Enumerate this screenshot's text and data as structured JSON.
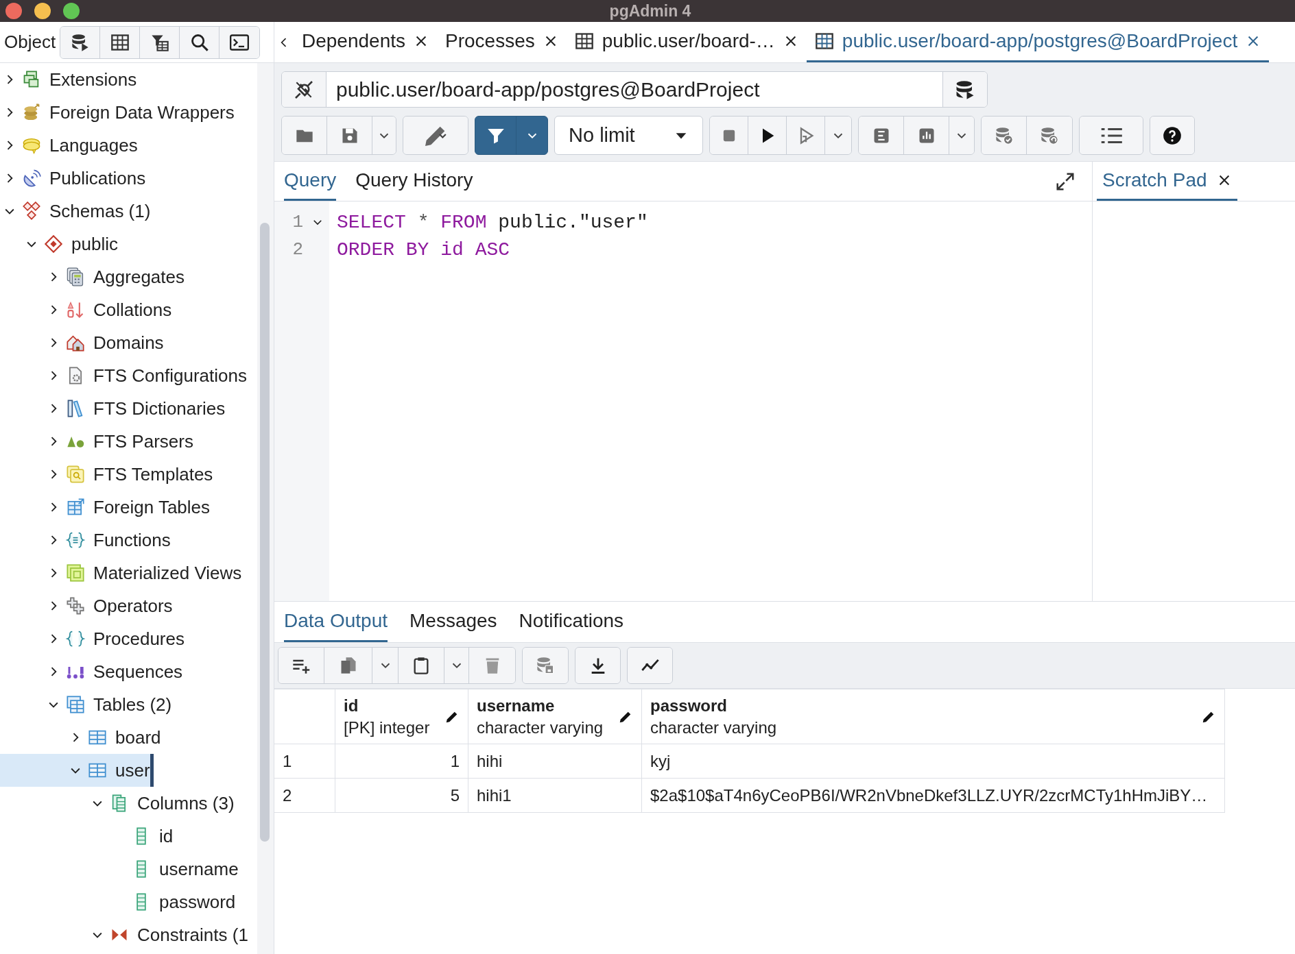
{
  "window": {
    "title": "pgAdmin 4"
  },
  "object_explorer": {
    "title": "Object",
    "tree": [
      {
        "label": "Extensions",
        "kind": "extension",
        "expanded": false,
        "selected": false
      },
      {
        "label": "Foreign Data Wrappers",
        "kind": "fdw",
        "expanded": false,
        "selected": false
      },
      {
        "label": "Languages",
        "kind": "language",
        "expanded": false,
        "selected": false
      },
      {
        "label": "Publications",
        "kind": "publication",
        "expanded": false,
        "selected": false
      },
      {
        "label": "Schemas (1)",
        "kind": "schemas",
        "expanded": true,
        "selected": false,
        "children": [
          {
            "label": "public",
            "kind": "schema",
            "expanded": true,
            "selected": false,
            "children": [
              {
                "label": "Aggregates",
                "kind": "aggregate",
                "expanded": false,
                "selected": false
              },
              {
                "label": "Collations",
                "kind": "collation",
                "expanded": false,
                "selected": false
              },
              {
                "label": "Domains",
                "kind": "domain",
                "expanded": false,
                "selected": false
              },
              {
                "label": "FTS Configurations",
                "kind": "fts-config",
                "expanded": false,
                "selected": false
              },
              {
                "label": "FTS Dictionaries",
                "kind": "fts-dict",
                "expanded": false,
                "selected": false
              },
              {
                "label": "FTS Parsers",
                "kind": "fts-parser",
                "expanded": false,
                "selected": false
              },
              {
                "label": "FTS Templates",
                "kind": "fts-template",
                "expanded": false,
                "selected": false
              },
              {
                "label": "Foreign Tables",
                "kind": "foreign-table",
                "expanded": false,
                "selected": false
              },
              {
                "label": "Functions",
                "kind": "function",
                "expanded": false,
                "selected": false
              },
              {
                "label": "Materialized Views",
                "kind": "matview",
                "expanded": false,
                "selected": false
              },
              {
                "label": "Operators",
                "kind": "operator",
                "expanded": false,
                "selected": false
              },
              {
                "label": "Procedures",
                "kind": "procedure",
                "expanded": false,
                "selected": false
              },
              {
                "label": "Sequences",
                "kind": "sequence",
                "expanded": false,
                "selected": false
              },
              {
                "label": "Tables (2)",
                "kind": "tables",
                "expanded": true,
                "selected": false,
                "children": [
                  {
                    "label": "board",
                    "kind": "table",
                    "expanded": false,
                    "selected": false
                  },
                  {
                    "label": "user",
                    "kind": "table",
                    "expanded": true,
                    "selected": true,
                    "children": [
                      {
                        "label": "Columns (3)",
                        "kind": "columns",
                        "expanded": true,
                        "selected": false,
                        "children": [
                          {
                            "label": "id",
                            "kind": "column",
                            "selected": false
                          },
                          {
                            "label": "username",
                            "kind": "column",
                            "selected": false
                          },
                          {
                            "label": "password",
                            "kind": "column",
                            "selected": false
                          }
                        ]
                      },
                      {
                        "label": "Constraints (1",
                        "kind": "constraint",
                        "expanded": true,
                        "selected": false
                      }
                    ]
                  }
                ]
              }
            ]
          }
        ]
      }
    ]
  },
  "tabs": [
    {
      "label": "Dependents",
      "kind": "panel",
      "selected": false
    },
    {
      "label": "Processes",
      "kind": "panel",
      "selected": false
    },
    {
      "label": "public.user/board-…",
      "kind": "query",
      "selected": false
    },
    {
      "label": "public.user/board-app/postgres@BoardProject",
      "kind": "query",
      "selected": true
    }
  ],
  "query_tool": {
    "connection": "public.user/board-app/postgres@BoardProject",
    "row_limit": "No limit",
    "editor_tabs": [
      {
        "label": "Query",
        "selected": true
      },
      {
        "label": "Query History",
        "selected": false
      }
    ],
    "scratch_pad": {
      "label": "Scratch Pad",
      "selected": true
    },
    "lines": [
      {
        "number": "1",
        "foldable": true,
        "tokens": [
          {
            "text": "SELECT",
            "kind": "keyword"
          },
          {
            "text": " * ",
            "kind": "operator"
          },
          {
            "text": "FROM",
            "kind": "keyword"
          },
          {
            "text": " public.\"user\"",
            "kind": "plain"
          }
        ]
      },
      {
        "number": "2",
        "foldable": false,
        "tokens": [
          {
            "text": "ORDER BY id ASC",
            "kind": "keyword"
          }
        ]
      }
    ]
  },
  "output": {
    "tabs": [
      {
        "label": "Data Output",
        "selected": true
      },
      {
        "label": "Messages",
        "selected": false
      },
      {
        "label": "Notifications",
        "selected": false
      }
    ],
    "columns": [
      {
        "name": "id",
        "type": "[PK] integer",
        "kind": "number"
      },
      {
        "name": "username",
        "type": "character varying",
        "kind": "text"
      },
      {
        "name": "password",
        "type": "character varying",
        "kind": "text"
      }
    ],
    "rows": [
      {
        "number": "1",
        "cells": [
          "1",
          "hihi",
          "kyj"
        ]
      },
      {
        "number": "2",
        "cells": [
          "5",
          "hihi1",
          "$2a$10$aT4n6yCeoPB6I/WR2nVbneDkef3LLZ.UYR/2zcrMCTy1hHmJiBY…"
        ]
      }
    ]
  }
}
